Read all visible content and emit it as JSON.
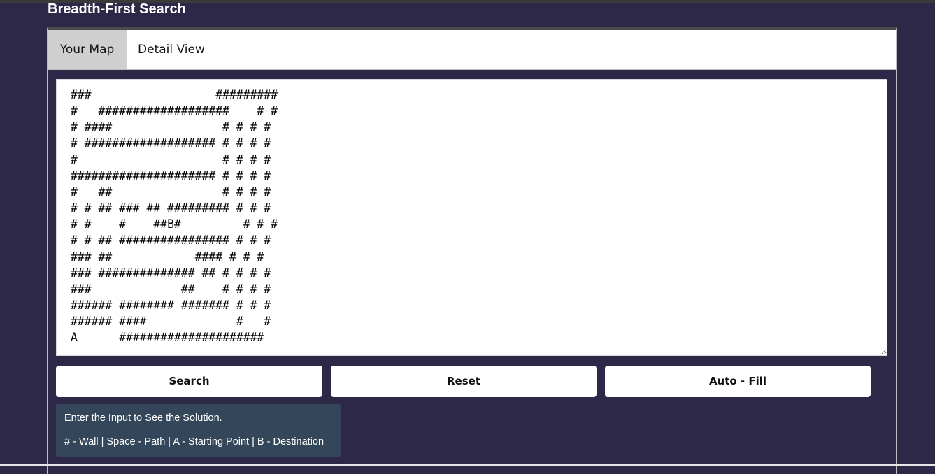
{
  "page": {
    "title": "Breadth-First Search"
  },
  "tabs": [
    {
      "label": "Your Map",
      "active": true
    },
    {
      "label": "Detail View",
      "active": false
    }
  ],
  "map": {
    "text": "###                  #########\n#   ###################    # #\n# ####                # # # #\n# ################### # # # #\n#                     # # # #\n##################### # # # #\n#   ##                # # # #\n# # ## ### ## ######### # # #\n# #    #    ##B#         # # #\n# # ## ################ # # #\n### ##            #### # # #\n### ############## ## # # # #\n###             ##    # # # #\n###### ######## ####### # # #\n###### ####             #   #\nA      #####################"
  },
  "buttons": {
    "search": "Search",
    "reset": "Reset",
    "autofill": "Auto - Fill"
  },
  "info": {
    "line1": "Enter the Input to See the Solution.",
    "line2": "# - Wall | Space - Path | A - Starting Point | B - Destination"
  },
  "colors": {
    "background": "#2d2847",
    "info_box": "#34475a",
    "active_tab": "#cfcfcf"
  }
}
